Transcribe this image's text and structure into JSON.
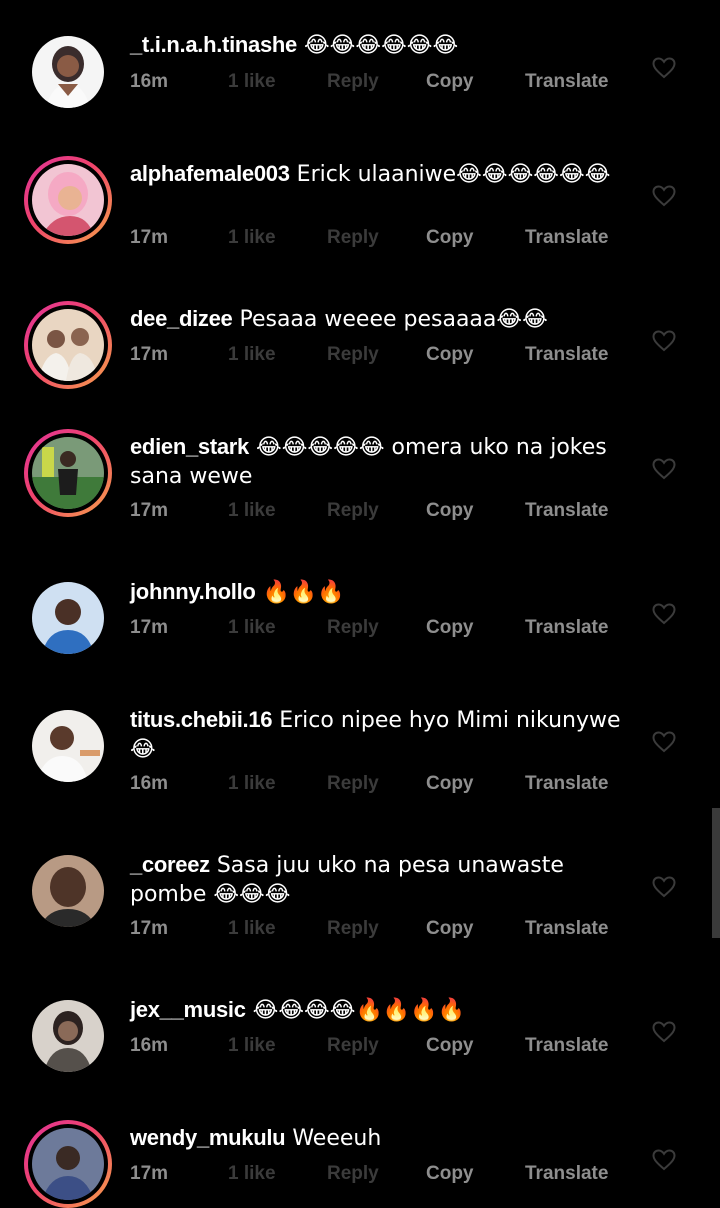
{
  "comments": [
    {
      "username": "_t.i.n.a.h.tinashe",
      "text": " 😂😂😂😂😂😂",
      "time": "16m",
      "likes": "1 like",
      "reply": "Reply",
      "copy": "Copy",
      "translate": "Translate",
      "has_story": false,
      "avatar_color": "#d8d0cc"
    },
    {
      "username": "alphafemale003",
      "text": " Erick ulaaniwe😂😂😂😂😂😂",
      "time": "17m",
      "likes": "1 like",
      "reply": "Reply",
      "copy": "Copy",
      "translate": "Translate",
      "has_story": true,
      "avatar_color": "#e7a0b2"
    },
    {
      "username": "dee_dizee",
      "text": " Pesaaa weeee pesaaaa😂😂",
      "time": "17m",
      "likes": "1 like",
      "reply": "Reply",
      "copy": "Copy",
      "translate": "Translate",
      "has_story": true,
      "avatar_color": "#d7b79a"
    },
    {
      "username": "edien_stark",
      "text": " 😂😂😂😂😂 omera uko na jokes sana wewe",
      "time": "17m",
      "likes": "1 like",
      "reply": "Reply",
      "copy": "Copy",
      "translate": "Translate",
      "has_story": true,
      "avatar_color": "#5f7d55"
    },
    {
      "username": "johnny.hollo",
      "text": " 🔥🔥🔥",
      "time": "17m",
      "likes": "1 like",
      "reply": "Reply",
      "copy": "Copy",
      "translate": "Translate",
      "has_story": false,
      "avatar_color": "#4d73b9"
    },
    {
      "username": "titus.chebii.16",
      "text": " Erico nipee hyo Mimi nikunywe 😂",
      "time": "16m",
      "likes": "1 like",
      "reply": "Reply",
      "copy": "Copy",
      "translate": "Translate",
      "has_story": false,
      "avatar_color": "#e6e2df"
    },
    {
      "username": "_coreez",
      "text": " Sasa juu uko na pesa unawaste pombe 😂😂😂",
      "time": "17m",
      "likes": "1 like",
      "reply": "Reply",
      "copy": "Copy",
      "translate": "Translate",
      "has_story": false,
      "avatar_color": "#6b4d3c"
    },
    {
      "username": "jex__music",
      "text": " 😂😂😂😂🔥🔥🔥🔥",
      "time": "16m",
      "likes": "1 like",
      "reply": "Reply",
      "copy": "Copy",
      "translate": "Translate",
      "has_story": false,
      "avatar_color": "#8f857c"
    },
    {
      "username": "wendy_mukulu",
      "text": " Weeeuh",
      "time": "17m",
      "likes": "1 like",
      "reply": "Reply",
      "copy": "Copy",
      "translate": "Translate",
      "has_story": true,
      "avatar_color": "#4a5677"
    }
  ]
}
